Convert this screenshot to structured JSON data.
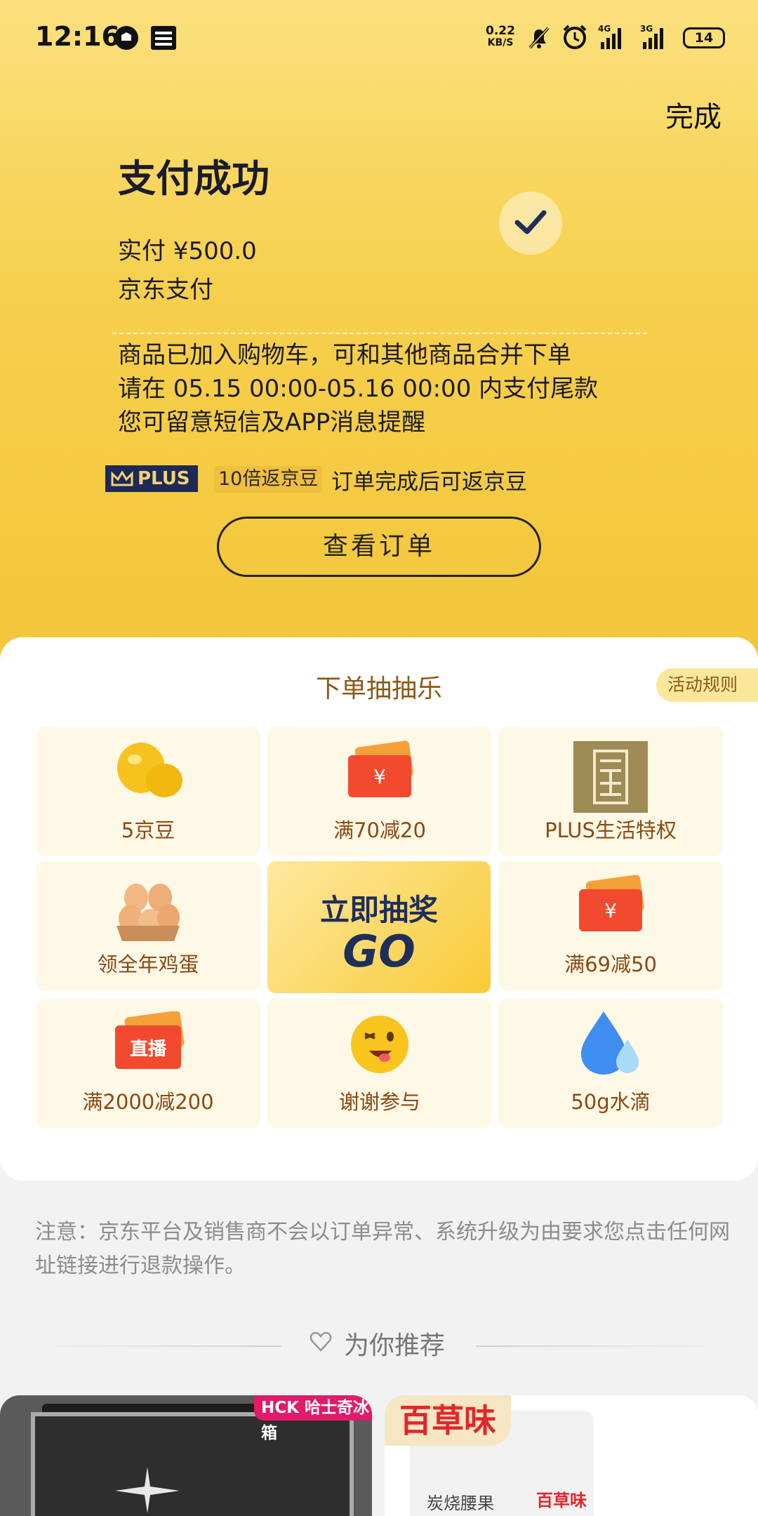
{
  "status_bar": {
    "time": "12:16",
    "net_speed_value": "0.22",
    "net_speed_unit": "KB/S",
    "net1": "4G",
    "net2": "3G",
    "battery": "14"
  },
  "header": {
    "done_label": "完成",
    "title": "支付成功",
    "amount_line": "实付 ¥500.0",
    "method_line": "京东支付"
  },
  "info_lines": [
    "商品已加入购物车，可和其他商品合并下单",
    "请在 05.15 00:00-05.16 00:00 内支付尾款",
    "您可留意短信及APP消息提醒"
  ],
  "plus": {
    "badge": "PLUS",
    "reward_tag": "10倍返京豆",
    "reward_note": "订单完成后可返京豆"
  },
  "view_order_label": "查看订单",
  "lottery": {
    "title": "下单抽抽乐",
    "rules_label": "活动规则",
    "go_title": "立即抽奖",
    "go_text": "GO",
    "prizes": [
      {
        "label": "5京豆",
        "icon": "beans-icon"
      },
      {
        "label": "满70减20",
        "icon": "coupon-icon"
      },
      {
        "label": "PLUS生活特权",
        "icon": "plus-life-icon"
      },
      {
        "label": "领全年鸡蛋",
        "icon": "eggs-icon"
      },
      {
        "label": "满69减50",
        "icon": "coupon-icon"
      },
      {
        "label": "满2000减200",
        "icon": "live-coupon-icon"
      },
      {
        "label": "谢谢参与",
        "icon": "wink-emoji-icon"
      },
      {
        "label": "50g水滴",
        "icon": "water-drop-icon"
      }
    ],
    "live_badge": "直播",
    "yen": "¥"
  },
  "notice": "注意：京东平台及销售商不会以订单异常、系统升级为由要求您点击任何网址链接进行退款操作。",
  "recommend": {
    "title": "为你推荐",
    "products": [
      {
        "tag": "HCK 哈士奇冰箱"
      },
      {
        "brand": "百草味",
        "pack_name": "炭烧腰果",
        "pack_brand": "百草味"
      }
    ]
  },
  "colors": {
    "header_gradient_top": "#fbe07d",
    "header_gradient_bottom": "#f3c63a",
    "lottery_text": "#8a4a14",
    "navy": "#1f2f5c",
    "cell_bg": "#fef8e6"
  }
}
